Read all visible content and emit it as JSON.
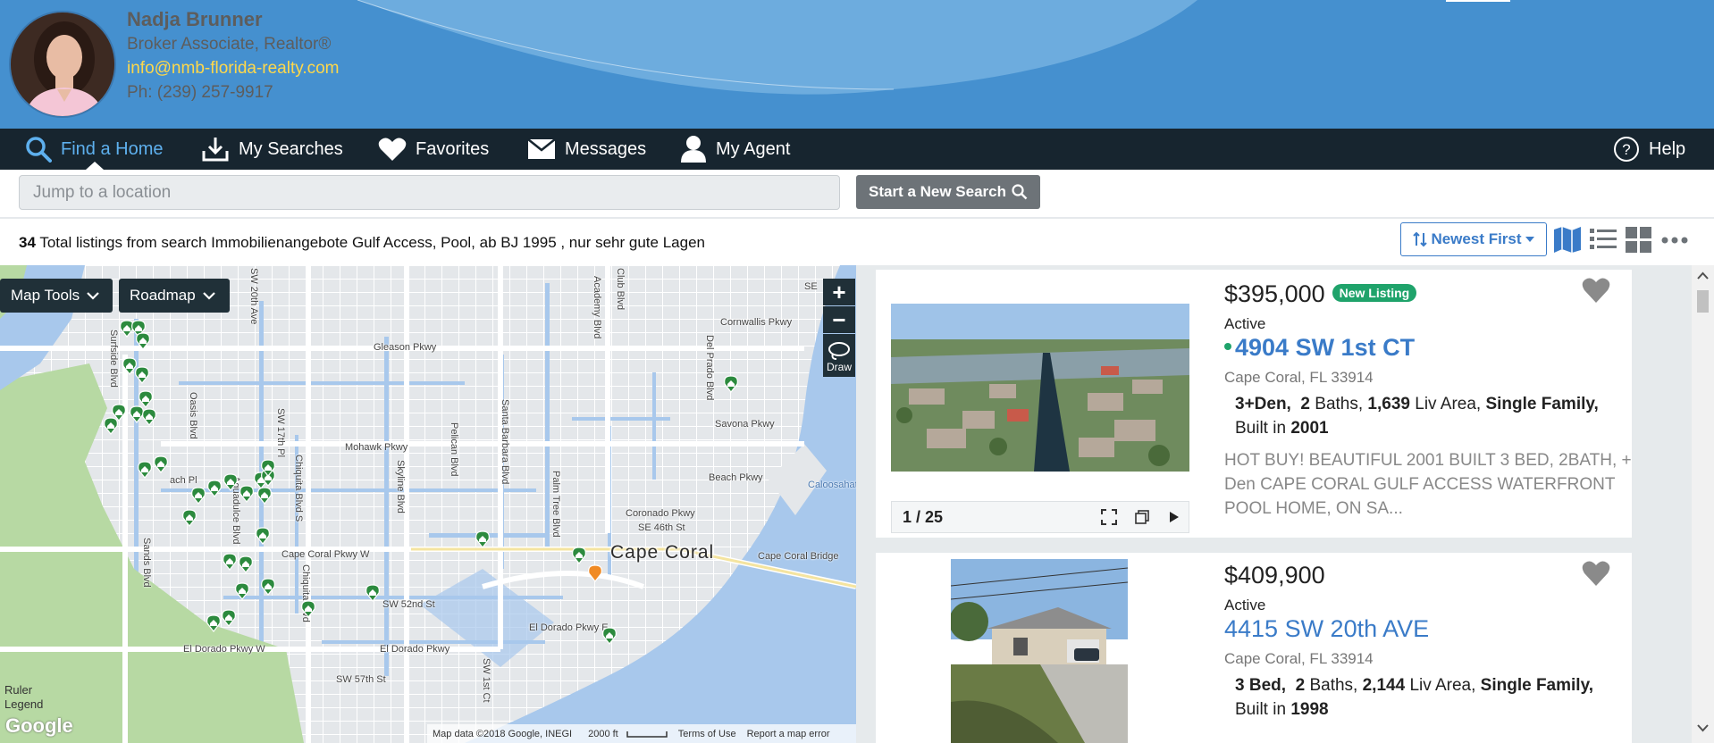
{
  "agent": {
    "name": "Nadja Brunner",
    "title": "Broker Associate, Realtor®",
    "email": "info@nmb-florida-realty.com",
    "phone": "Ph: (239) 257-9917"
  },
  "nav": {
    "items": [
      {
        "label": "Find a Home",
        "icon": "search-icon",
        "active": true
      },
      {
        "label": "My Searches",
        "icon": "download-icon"
      },
      {
        "label": "Favorites",
        "icon": "heart-icon"
      },
      {
        "label": "Messages",
        "icon": "envelope-icon"
      },
      {
        "label": "My Agent",
        "icon": "user-icon"
      }
    ],
    "help": "Help"
  },
  "search": {
    "placeholder": "Jump to a location",
    "button": "Start a New Search"
  },
  "results": {
    "count": "34",
    "text": "Total listings from search Immobilienangebote Gulf Access, Pool, ab BJ 1995 , nur sehr gute Lagen",
    "sort": "Newest First"
  },
  "map": {
    "tools": "Map Tools",
    "type": "Roadmap",
    "draw": "Draw",
    "zoom_in": "+",
    "zoom_out": "−",
    "city": "Cape Coral",
    "streets": {
      "sw20th": "SW 20th Ave",
      "club": "Club Blvd",
      "academy": "Academy Blvd",
      "se": "SE",
      "cornwallis": "Cornwallis Pkwy",
      "gleason": "Gleason Pkwy",
      "surfside": "Surfside Blvd",
      "oasis": "Oasis Blvd",
      "sw17th": "SW 17th Pl",
      "chiquita": "Chiquita Blvd S",
      "pelican": "Pelican Blvd",
      "santabarbara": "Santa Barbara Blvd",
      "delprado": "Del Prado Blvd",
      "savona": "Savona Pkwy",
      "mohawk": "Mohawk Pkwy",
      "skyline": "Skyline Blvd",
      "beach": "Beach Pkwy",
      "aguadulce": "Aguadulce Blvd",
      "palmtree": "Palm Tree Blvd",
      "coronado": "Coronado Pkwy",
      "caloosahatchee": "Caloosahatc",
      "sands": "Sands Blvd",
      "capecoralpkwy": "Cape Coral Pkwy W",
      "se46": "SE 46th St",
      "capecoralbridge": "Cape Coral Bridge",
      "chiquita2": "Chiquita Blvd",
      "sw52": "SW 52nd St",
      "eldoradoE": "El Dorado Pkwy E",
      "eldoradoW": "El Dorado Pkwy W",
      "eldorado2": "El Dorado Pkwy",
      "sw57": "SW 57th St",
      "sw1st": "SW 1st Ct",
      "beachLeft": "ach Pl"
    },
    "ruler": "Ruler",
    "legend": "Legend",
    "google": "Google",
    "attribution": "Map data ©2018 Google, INEGI",
    "scale": "2000 ft",
    "terms": "Terms of Use",
    "report": "Report a map error"
  },
  "listings": [
    {
      "price": "$395,000",
      "badge": "New Listing",
      "status": "Active",
      "address": "4904 SW 1st CT",
      "city": "Cape Coral, FL 33914",
      "beds": "3+Den,",
      "baths": "2",
      "baths_label": "Baths,",
      "area": "1,639",
      "area_label": "Liv Area,",
      "type": "Single Family,",
      "built_label": "Built in",
      "year": "2001",
      "photo_count": "1 / 25",
      "description": "HOT BUY! BEAUTIFUL 2001 BUILT 3 BED, 2BATH, + Den CAPE CORAL GULF ACCESS WATERFRONT POOL HOME, ON SA..."
    },
    {
      "price": "$409,900",
      "status": "Active",
      "address": "4415 SW 20th AVE",
      "city": "Cape Coral, FL 33914",
      "beds": "3 Bed,",
      "baths": "2",
      "baths_label": "Baths,",
      "area": "2,144",
      "area_label": "Liv Area,",
      "type": "Single Family,",
      "built_label": "Built in",
      "year": "1998"
    }
  ],
  "colors": {
    "header": "#4590cf",
    "nav": "#17252f",
    "nav_active": "#5eb0ee",
    "link": "#3a7bc8",
    "badge": "#1fa36b",
    "email": "#ffd84a"
  }
}
